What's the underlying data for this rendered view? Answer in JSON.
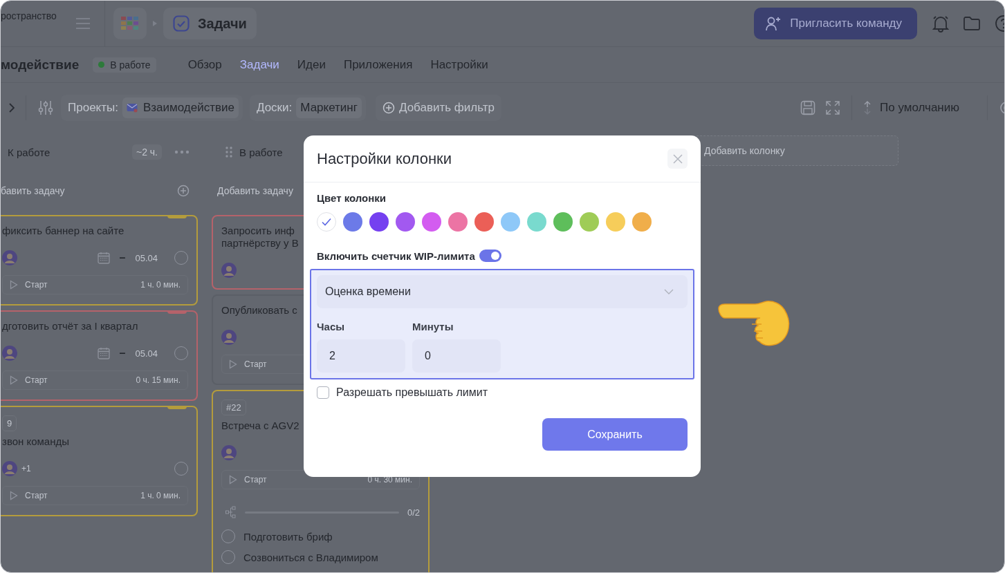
{
  "topbar": {
    "workspace": "ространство",
    "breadcrumb": "Задачи",
    "invite": "Пригласить команду"
  },
  "project": {
    "name": "модействие",
    "status": "В работе"
  },
  "nav_tabs": [
    {
      "label": "Обзор",
      "selected": false
    },
    {
      "label": "Задачи",
      "selected": true
    },
    {
      "label": "Идеи",
      "selected": false
    },
    {
      "label": "Приложения",
      "selected": false
    },
    {
      "label": "Настройки",
      "selected": false
    }
  ],
  "filters": {
    "projects_label": "Проекты:",
    "project": "Взаимодействие",
    "boards_label": "Доски:",
    "board": "Маркетинг",
    "add_filter": "Добавить фильтр",
    "sort": "По умолчанию"
  },
  "columns": [
    {
      "title": "К работе",
      "estimate": "~2 ч.",
      "add_task": "бавить задачу",
      "cards": [
        {
          "color": "#b49c3c",
          "flag": true,
          "title": [
            "фиксить баннер на сайте"
          ],
          "avatar": true,
          "date_start": "–",
          "date_end": "05.04",
          "done": false,
          "start": "Старт",
          "time": "1 ч. 0 мин."
        },
        {
          "color": "#b5626a",
          "flag": true,
          "title": [
            "дготовить отчёт за I квартал"
          ],
          "avatar": true,
          "date_start": "–",
          "date_end": "05.04",
          "done": false,
          "start": "Старт",
          "time": "0 ч. 15 мин."
        },
        {
          "color": "#b49c3c",
          "flag": true,
          "tag": "9",
          "title": [
            "звон команды"
          ],
          "avatar": true,
          "extra": "+1",
          "done": false,
          "start": "Старт",
          "time": "1 ч. 0 мин."
        }
      ]
    },
    {
      "title": "В работе",
      "drag_handle": true,
      "add_task": "Добавить задачу",
      "cards": [
        {
          "color": "#b5626a",
          "title": [
            "Запросить инф",
            "партнёрству у В"
          ],
          "avatar": true
        },
        {
          "title": [
            "Опубликовать с"
          ],
          "avatar": true,
          "start": "Старт"
        },
        {
          "color": "#b49c3c",
          "tag": "#22",
          "title": [
            "Встреча с AGV2"
          ],
          "avatar": true,
          "start": "Старт",
          "time": "0 ч. 30 мин.",
          "subtasks": {
            "count": "0/2",
            "level": 0,
            "items": [
              {
                "label": "Подготовить бриф",
                "done": false
              },
              {
                "label": "Созвониться с Владимиром",
                "done": false
              }
            ]
          }
        }
      ]
    }
  ],
  "add_column": "Добавить колонку",
  "dialog": {
    "title": "Настройки колонки",
    "color_label": "Цвет колонки",
    "swatches": [
      {
        "color": "#ffffff",
        "selected": true
      },
      {
        "color": "#6c7ae8",
        "selected": false
      },
      {
        "color": "#7540f0",
        "selected": false
      },
      {
        "color": "#a259f0",
        "selected": false
      },
      {
        "color": "#d35cf0",
        "selected": false
      },
      {
        "color": "#ec74a4",
        "selected": false
      },
      {
        "color": "#eb5f57",
        "selected": false
      },
      {
        "color": "#8ec8f8",
        "selected": false
      },
      {
        "color": "#79dace",
        "selected": false
      },
      {
        "color": "#5ebe5b",
        "selected": false
      },
      {
        "color": "#9fcc57",
        "selected": false
      },
      {
        "color": "#f6cd5a",
        "selected": false
      },
      {
        "color": "#f0ae4a",
        "selected": false
      }
    ],
    "wip_label": "Включить счетчик WIP-лимита",
    "wip_on": true,
    "mode": "Оценка времени",
    "hours_label": "Часы",
    "hours": "2",
    "minutes_label": "Минуты",
    "minutes": "0",
    "allow_exceed": {
      "label": "Разрешать превышать лимит",
      "checked": false
    },
    "save": "Сохранить"
  }
}
